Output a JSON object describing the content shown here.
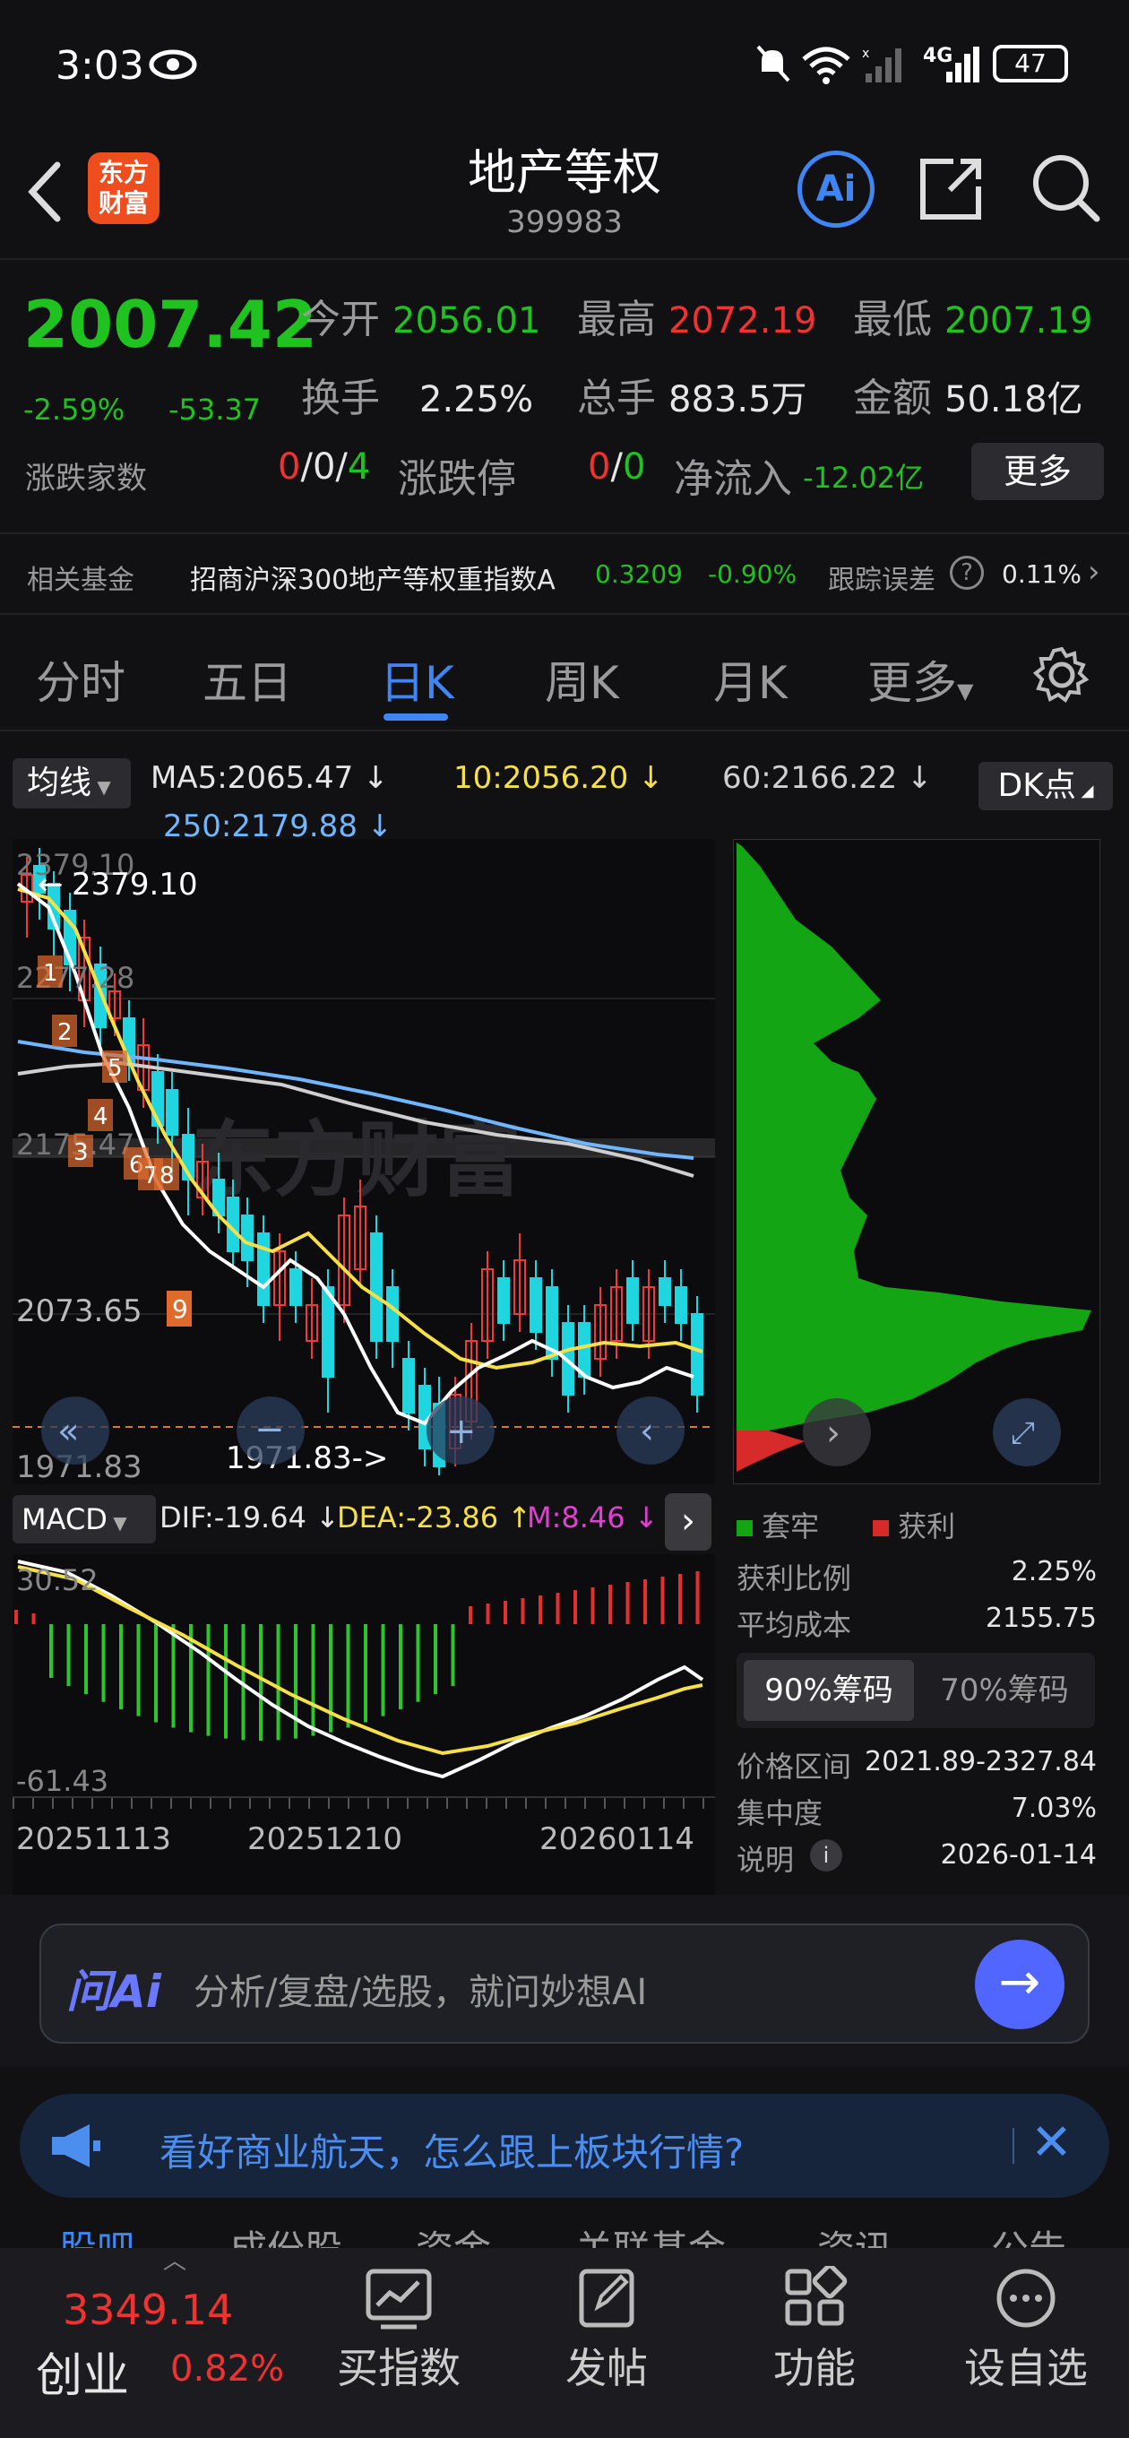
{
  "status": {
    "time": "3:03",
    "battery": "47",
    "net": "4G"
  },
  "header": {
    "title": "地产等权",
    "code": "399983",
    "ai": "Ai",
    "logo_line1": "东方",
    "logo_line2": "财富"
  },
  "quote": {
    "price": "2007.42",
    "pct": "-2.59%",
    "chg": "-53.37",
    "stats": [
      {
        "label": "今开",
        "value": "2056.01",
        "color": "#1fc21f"
      },
      {
        "label": "最高",
        "value": "2072.19",
        "color": "#f23131"
      },
      {
        "label": "最低",
        "value": "2007.19",
        "color": "#1fc21f"
      },
      {
        "label": "换手",
        "value": "2.25%",
        "color": "#e6e6e6"
      },
      {
        "label": "总手",
        "value": "883.5万",
        "color": "#e6e6e6"
      },
      {
        "label": "金额",
        "value": "50.18亿",
        "color": "#e6e6e6"
      }
    ],
    "updown_label": "涨跌家数",
    "up": "0",
    "flat": "0",
    "down": "4",
    "limit_label": "涨跌停",
    "limit_up": "0",
    "limit_down": "0",
    "netflow_label": "净流入",
    "netflow": "-12.02亿",
    "more": "更多",
    "fund_label": "相关基金",
    "fund_name": "招商沪深300地产等权重指数A",
    "fund_nav": "0.3209",
    "fund_pct": "-0.90%",
    "track_label": "跟踪误差",
    "track_value": "0.11%"
  },
  "tabs": [
    {
      "label": "分时"
    },
    {
      "label": "五日"
    },
    {
      "label": "日K"
    },
    {
      "label": "周K"
    },
    {
      "label": "月K"
    },
    {
      "label": "更多"
    }
  ],
  "ma": {
    "btn": "均线",
    "ma5": "MA5:2065.47",
    "ma10": "10:2056.20",
    "ma60": "60:2166.22",
    "ma250": "250:2179.88",
    "dk": "DK点"
  },
  "kline": {
    "y_labels": [
      "2379.10",
      "2277.28",
      "2175.47",
      "2073.65",
      "1971.83"
    ],
    "high_mark": "2379.10",
    "low_mark": "1971.83->",
    "watermark": "东方财富",
    "badges": [
      "1",
      "2",
      "3",
      "4",
      "5",
      "6",
      "7",
      "8",
      "9"
    ]
  },
  "macd": {
    "btn": "MACD",
    "dif": "DIF:-19.64",
    "dea": "DEA:-23.86",
    "m": "M:8.46",
    "y_top": "30.52",
    "y_bot": "-61.43"
  },
  "dates": [
    "20251113",
    "20251210",
    "20260114"
  ],
  "chip": {
    "legend_trap": "套牢",
    "legend_profit": "获利",
    "rows": [
      {
        "label": "获利比例",
        "value": "2.25%"
      },
      {
        "label": "平均成本",
        "value": "2155.75"
      }
    ],
    "tab90": "90%筹码",
    "tab70": "70%筹码",
    "rows2": [
      {
        "label": "价格区间",
        "value": "2021.89-2327.84"
      },
      {
        "label": "集中度",
        "value": "7.03%"
      },
      {
        "label": "说明",
        "value": "2026-01-14"
      }
    ]
  },
  "ask": {
    "logo": "问Ai",
    "placeholder": "分析/复盘/选股，就问妙想AI"
  },
  "banner": {
    "text": "看好商业航天，怎么跟上板块行情?"
  },
  "scroll_tabs": [
    "股吧",
    "成份股",
    "资金",
    "关联基金",
    "资讯",
    "公告"
  ],
  "bottom": {
    "index_value": "3349.14",
    "index_name": "创业",
    "index_pct": "0.82%",
    "items": [
      {
        "label": "买指数"
      },
      {
        "label": "发帖"
      },
      {
        "label": "功能"
      },
      {
        "label": "设自选"
      }
    ]
  }
}
